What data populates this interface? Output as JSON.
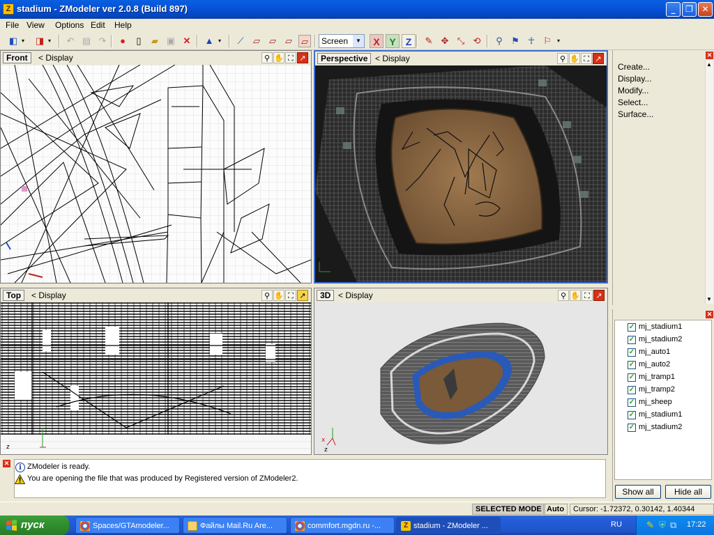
{
  "window": {
    "title": "stadium - ZModeler ver 2.0.8 (Build 897)",
    "icon": "Z",
    "controls": {
      "minimize": "_",
      "maximize": "❐",
      "close": "✕"
    }
  },
  "menu": [
    "File",
    "View",
    "Options",
    "Edit",
    "Help"
  ],
  "toolbar": {
    "icons": [
      "open-icon",
      "save-icon",
      "undo-icon",
      "redo-icon",
      "record-icon",
      "new-icon",
      "open-folder-icon",
      "save-disk-icon",
      "delete-icon",
      "pen-tool-icon",
      "vertex-icon",
      "box-icon",
      "box-select-icon",
      "box-edit-icon",
      "box-active-icon",
      "axis-x-icon",
      "axis-y-icon",
      "axis-z-icon",
      "paint-icon",
      "move-icon",
      "scale-icon",
      "rotate-icon",
      "link-icon",
      "walk-icon",
      "flag-icon"
    ],
    "space_select": "Screen",
    "axes": {
      "x": "X",
      "y": "Y",
      "z": "Z"
    }
  },
  "viewports": {
    "front": {
      "name": "Front",
      "display": "<  Display"
    },
    "perspective": {
      "name": "Perspective",
      "display": "<  Display"
    },
    "top": {
      "name": "Top",
      "display": "<  Display"
    },
    "three_d": {
      "name": "3D",
      "display": "<  Display"
    }
  },
  "commands": [
    "Create...",
    "Display...",
    "Modify...",
    "Select...",
    "Surface..."
  ],
  "objects": [
    {
      "name": "mj_stadium1",
      "checked": true
    },
    {
      "name": "mj_stadium2",
      "checked": true
    },
    {
      "name": "mj_auto1",
      "checked": true
    },
    {
      "name": "mj_auto2",
      "checked": true
    },
    {
      "name": "mj_tramp1",
      "checked": true
    },
    {
      "name": "mj_tramp2",
      "checked": true
    },
    {
      "name": "mj_sheep",
      "checked": true
    },
    {
      "name": "mj_stadium1",
      "checked": true
    },
    {
      "name": "mj_stadium2",
      "checked": true
    }
  ],
  "object_buttons": {
    "show_all": "Show all",
    "hide_all": "Hide all"
  },
  "log": [
    {
      "type": "info",
      "text": "ZModeler is ready."
    },
    {
      "type": "warning",
      "text": "You are opening the file that was produced by Registered version of ZModeler2."
    }
  ],
  "status": {
    "mode": "SELECTED MODE",
    "auto": "Auto",
    "cursor": "Cursor: -1.72372, 0.30142, 1.40344"
  },
  "taskbar": {
    "start": "пуск",
    "tasks": [
      {
        "label": "Spaces/GTAmodeler...",
        "active": false
      },
      {
        "label": "Файлы Mail.Ru Are...",
        "active": false
      },
      {
        "label": "commfort.mgdn.ru -...",
        "active": false
      },
      {
        "label": "stadium - ZModeler ...",
        "active": true
      }
    ],
    "lang": "RU",
    "clock": "17:22"
  },
  "colors": {
    "accent": "#0a5fe0",
    "active_viewport": "#3b6fd6",
    "arena_floor": "#7a5a38"
  }
}
